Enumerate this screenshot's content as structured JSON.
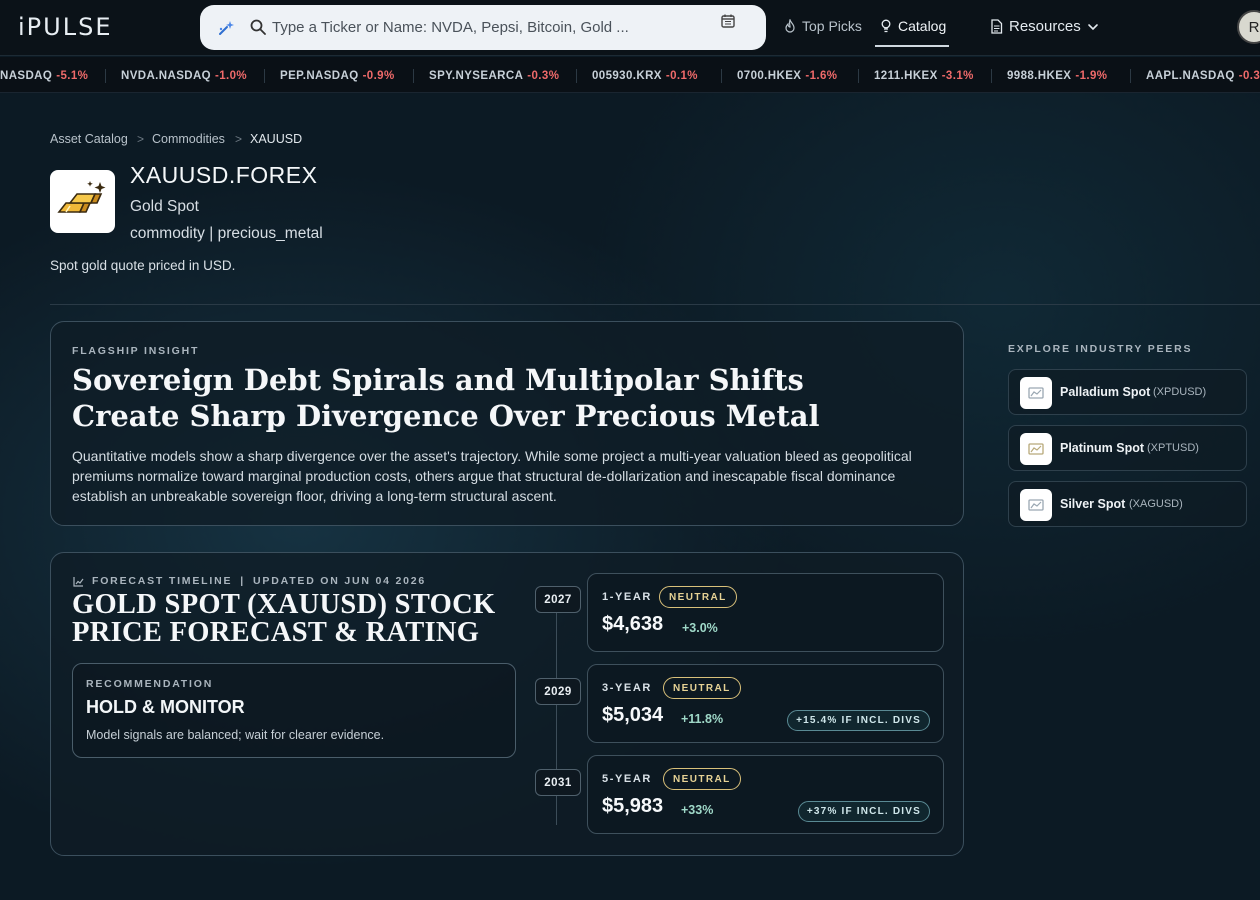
{
  "app": {
    "logo": "iPULSE",
    "avatar_initial": "R"
  },
  "search": {
    "placeholder": "Type a Ticker or Name: NVDA, Pepsi, Bitcoin, Gold ..."
  },
  "nav": {
    "top_picks": "Top Picks",
    "catalog": "Catalog",
    "resources": "Resources"
  },
  "ticker": [
    {
      "symbol": "NASDAQ",
      "change": "-5.1%"
    },
    {
      "symbol": "NVDA.NASDAQ",
      "change": "-1.0%"
    },
    {
      "symbol": "PEP.NASDAQ",
      "change": "-0.9%"
    },
    {
      "symbol": "SPY.NYSEARCA",
      "change": "-0.3%"
    },
    {
      "symbol": "005930.KRX",
      "change": "-0.1%"
    },
    {
      "symbol": "0700.HKEX",
      "change": "-1.6%"
    },
    {
      "symbol": "1211.HKEX",
      "change": "-3.1%"
    },
    {
      "symbol": "9988.HKEX",
      "change": "-1.9%"
    },
    {
      "symbol": "AAPL.NASDAQ",
      "change": "-0.3"
    }
  ],
  "breadcrumb": [
    "Asset Catalog",
    "Commodities",
    "XAUUSD"
  ],
  "asset": {
    "ticker": "XAUUSD.FOREX",
    "name": "Gold Spot",
    "category": "commodity | precious_metal",
    "description": "Spot gold quote priced in USD.",
    "logo_icon": "gold-bars-icon"
  },
  "insight": {
    "eyebrow": "FLAGSHIP INSIGHT",
    "title": "Sovereign Debt Spirals and Multipolar Shifts Create Sharp Divergence Over Precious Metal",
    "body": "Quantitative models show a sharp divergence over the asset's trajectory. While some project a multi-year valuation bleed as geopolitical premiums normalize toward marginal production costs, others argue that structural de-dollarization and inescapable fiscal dominance establish an unbreakable sovereign floor, driving a long-term structural ascent."
  },
  "forecast": {
    "eyebrow_left": "FORECAST TIMELINE",
    "eyebrow_sep": "|",
    "eyebrow_right": "UPDATED ON JUN 04 2026",
    "title": "GOLD SPOT (XAUUSD) STOCK PRICE FORECAST & RATING",
    "recommendation": {
      "eyebrow": "RECOMMENDATION",
      "title": "HOLD & MONITOR",
      "body": "Model signals are balanced; wait for clearer evidence."
    },
    "items": [
      {
        "year": "2027",
        "horizon": "1-YEAR",
        "rating": "NEUTRAL",
        "price": "$4,638",
        "change": "+3.0%",
        "divs": ""
      },
      {
        "year": "2029",
        "horizon": "3-YEAR",
        "rating": "NEUTRAL",
        "price": "$5,034",
        "change": "+11.8%",
        "divs": "+15.4% IF INCL. DIVS"
      },
      {
        "year": "2031",
        "horizon": "5-YEAR",
        "rating": "NEUTRAL",
        "price": "$5,983",
        "change": "+33%",
        "divs": "+37% IF INCL. DIVS"
      }
    ]
  },
  "peers": {
    "title": "EXPLORE INDUSTRY PEERS",
    "items": [
      {
        "name": "Palladium Spot",
        "code": "(XPDUSD)"
      },
      {
        "name": "Platinum Spot",
        "code": "(XPTUSD)"
      },
      {
        "name": "Silver Spot",
        "code": "(XAGUSD)"
      }
    ]
  },
  "colors": {
    "negative": "#ef6a6a",
    "positive": "#9fd8c8",
    "neutral_badge": "#d9c07a",
    "background": "#0c1a24"
  }
}
